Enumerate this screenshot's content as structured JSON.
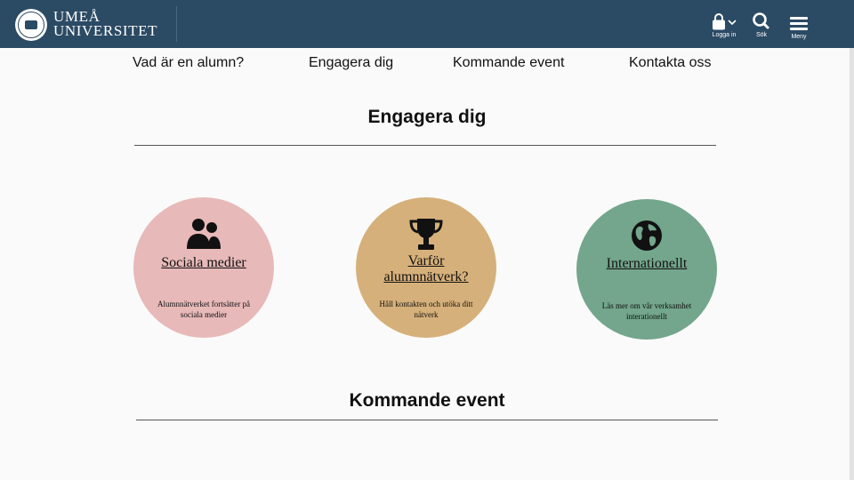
{
  "header": {
    "brand_line1": "UMEÅ",
    "brand_line2": "UNIVERSITET",
    "login_label": "Logga in",
    "search_label": "Sök",
    "menu_label": "Meny"
  },
  "subnav": [
    "Vad är en alumn?",
    "Engagera dig",
    "Kommande event",
    "Kontakta oss"
  ],
  "sections": {
    "engage_title": "Engagera dig",
    "events_title": "Kommande event"
  },
  "cards": [
    {
      "title": "Sociala medier",
      "description": "Alumnnätverket fortsätter på sociala medier",
      "icon": "users-icon",
      "color": "#e8b9b9"
    },
    {
      "title": "Varför alumnnätverk?",
      "description": "Håll kontakten och utöka ditt nätverk",
      "icon": "trophy-icon",
      "color": "#d6b07a"
    },
    {
      "title": "Internationellt",
      "description": "Läs mer om vår verksamhet interationellt",
      "icon": "globe-icon",
      "color": "#73a68c"
    }
  ],
  "colors": {
    "header_bg": "#2b4a64",
    "page_bg": "#fafafa"
  }
}
